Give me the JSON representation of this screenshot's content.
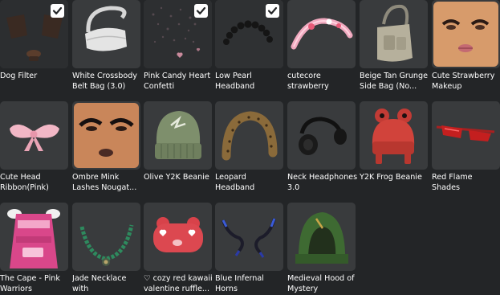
{
  "avatar_items": [
    {
      "name": "Dog Filter",
      "icon": "dog-filter-icon",
      "selected": true
    },
    {
      "name": "White Crossbody\nBelt Bag (3.0)",
      "icon": "belt-bag-icon",
      "selected": false
    },
    {
      "name": "Pink Candy Heart\nConfetti",
      "icon": "heart-confetti-icon",
      "selected": true
    },
    {
      "name": "Low Pearl\nHeadband",
      "icon": "pearl-headband-icon",
      "selected": true
    },
    {
      "name": "cutecore\nstrawberry flower...",
      "icon": "strawberry-headband-icon",
      "selected": false
    },
    {
      "name": "Beige Tan Grunge\nSide Bag (No...",
      "icon": "side-bag-icon",
      "selected": false
    },
    {
      "name": "Cute Strawberry\nMakeup",
      "icon": "makeup-face-icon",
      "selected": false
    },
    {
      "name": "Cute Head\nRibbon(Pink)",
      "icon": "pink-ribbon-icon",
      "selected": false
    },
    {
      "name": "Ombre Mink\nLashes Nougat...",
      "icon": "lashes-face-icon",
      "selected": false
    },
    {
      "name": "Olive Y2K Beanie",
      "icon": "beanie-icon",
      "selected": false
    },
    {
      "name": "Leopard Headband",
      "icon": "leopard-headband-icon",
      "selected": false
    },
    {
      "name": "Neck Headphones\n3.0",
      "icon": "headphones-icon",
      "selected": false
    },
    {
      "name": "Y2K Frog Beanie",
      "icon": "frog-beanie-icon",
      "selected": false
    },
    {
      "name": "Red Flame Shades\nRaised",
      "icon": "sunglasses-icon",
      "selected": false
    },
    {
      "name": "The Cape - Pink\nWarriors",
      "icon": "cape-icon",
      "selected": false
    },
    {
      "name": "Jade Necklace with\nShell Pendant",
      "icon": "necklace-icon",
      "selected": false
    },
    {
      "name": "♡ cozy red kawaii\nvalentine ruffle...",
      "icon": "sleep-mask-icon",
      "selected": false
    },
    {
      "name": "Blue Infernal Horns",
      "icon": "horns-icon",
      "selected": false
    },
    {
      "name": "Medieval Hood of\nMystery",
      "icon": "hood-icon",
      "selected": false
    }
  ],
  "colors": {
    "background": "#232527",
    "tile": "#393b3d",
    "text": "#ffffff",
    "check_bg": "#ffffff",
    "check_mark": "#232527"
  }
}
